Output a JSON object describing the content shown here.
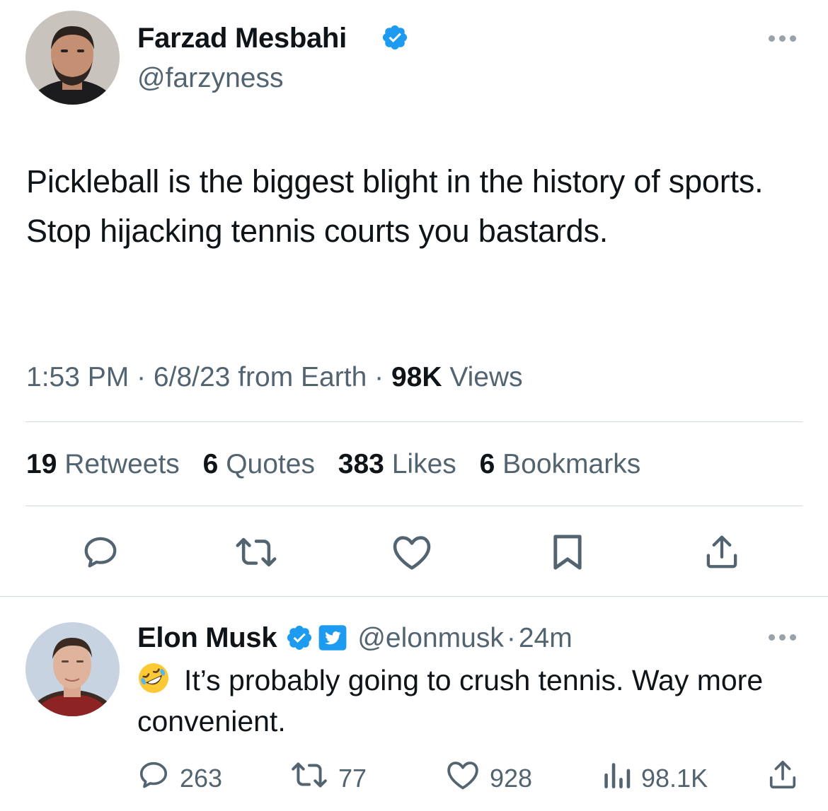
{
  "tweet": {
    "author_name": "Farzad Mesbahi",
    "author_handle": "@farzyness",
    "text": "Pickleball is the biggest blight in the history of sports. Stop hijacking tennis courts you bastards.",
    "time": "1:53 PM",
    "date": "6/8/23",
    "source": "from Earth",
    "views_count": "98K",
    "views_label": "Views",
    "stats": [
      {
        "count": "19",
        "label": "Retweets"
      },
      {
        "count": "6",
        "label": "Quotes"
      },
      {
        "count": "383",
        "label": "Likes"
      },
      {
        "count": "6",
        "label": "Bookmarks"
      }
    ],
    "actions": [
      "reply-icon",
      "retweet-icon",
      "like-icon",
      "bookmark-icon",
      "share-icon"
    ]
  },
  "reply": {
    "author_name": "Elon Musk",
    "author_handle": "@elonmusk",
    "separator": "·",
    "time_ago": "24m",
    "emoji": "rolling-on-the-floor-laughing-emoji",
    "text": "It’s probably going to crush tennis. Way more convenient.",
    "counts": {
      "replies": "263",
      "retweets": "77",
      "likes": "928",
      "views": "98.1K"
    }
  },
  "colors": {
    "verified": "#1d9bf0",
    "text": "#0f1419",
    "muted": "#536471",
    "divider": "#cfd9de"
  }
}
